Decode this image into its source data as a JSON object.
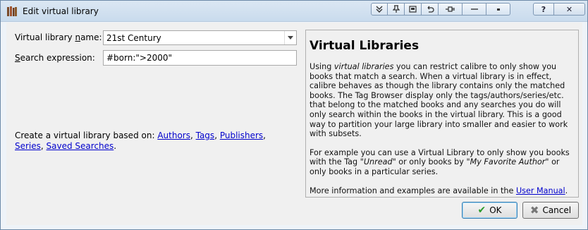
{
  "window": {
    "title": "Edit virtual library",
    "toolbar_icons": [
      "double-chevron-down-icon",
      "pin-icon",
      "restore-icon",
      "undo-icon",
      "plug-icon",
      "minus-icon",
      "minimize-icon"
    ],
    "help_label": "?",
    "close_label": "✕"
  },
  "form": {
    "name_label": "Virtual library name:",
    "name_value": "21st Century",
    "search_label": "Search expression:",
    "search_value": "#born:\">2000\"",
    "create_prefix": "Create a virtual library based on: ",
    "links": [
      "Authors",
      "Tags",
      "Publishers",
      "Series",
      "Saved Searches"
    ]
  },
  "help": {
    "title": "Virtual Libraries",
    "p1_a": "Using ",
    "p1_em": "virtual libraries",
    "p1_b": " you can restrict calibre to only show you books that match a search. When a virtual library is in effect, calibre behaves as though the library contains only the matched books. The Tag Browser display only the tags/authors/series/etc. that belong to the matched books and any searches you do will only search within the books in the virtual library. This is a good way to partition your large library into smaller and easier to work with subsets.",
    "p2_a": "For example you can use a Virtual Library to only show you books with the Tag ",
    "p2_em1": "\"Unread\"",
    "p2_b": " or only books by ",
    "p2_em2": "\"My Favorite Author\"",
    "p2_c": " or only books in a particular series.",
    "p3_a": "More information and examples are available in the ",
    "p3_link": "User Manual",
    "p3_b": "."
  },
  "buttons": {
    "ok": "OK",
    "cancel": "Cancel"
  }
}
